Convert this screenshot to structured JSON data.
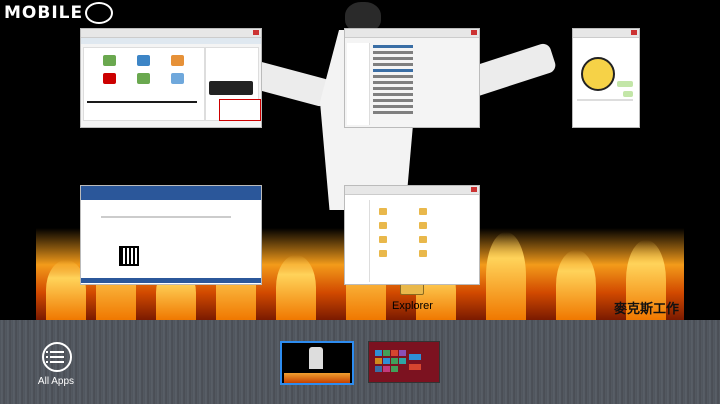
{
  "watermark": {
    "text": "MOBILE",
    "logo_icon": "mobile01-logo"
  },
  "wallpaper": {
    "brand_text": "麥克斯工作",
    "explorer_label": "Explorer"
  },
  "windows": [
    {
      "name": "browser-window"
    },
    {
      "name": "file-explorer-window"
    },
    {
      "name": "chat-window"
    },
    {
      "name": "word-document-window"
    },
    {
      "name": "folder-window"
    }
  ],
  "switcher": {
    "all_apps_label": "All Apps",
    "all_apps_icon": "list-icon",
    "thumbnails": [
      {
        "name": "thumb-desktop",
        "active": true
      },
      {
        "name": "thumb-start-screen",
        "active": false
      }
    ]
  },
  "colors": {
    "accent": "#2d8cf0",
    "switcher_bg": "#555a62",
    "start_bg": "#7c1220"
  }
}
